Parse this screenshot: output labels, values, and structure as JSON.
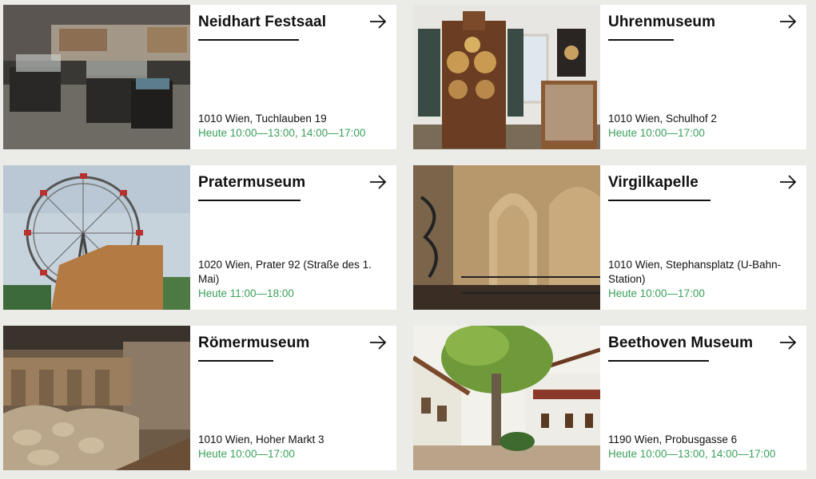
{
  "museums": [
    {
      "title": "Neidhart Festsaal",
      "address": "1010 Wien, Tuchlauben 19",
      "hours": "Heute 10:00—13:00, 14:00—17:00"
    },
    {
      "title": "Uhrenmuseum",
      "address": "1010 Wien, Schulhof 2",
      "hours": "Heute 10:00—17:00"
    },
    {
      "title": "Pratermuseum",
      "address": "1020 Wien, Prater 92 (Straße des 1. Mai)",
      "hours": "Heute 11:00—18:00"
    },
    {
      "title": "Virgilkapelle",
      "address": "1010 Wien, Stephansplatz (U-Bahn-Station)",
      "hours": "Heute 10:00—17:00"
    },
    {
      "title": "Römermuseum",
      "address": "1010 Wien, Hoher Markt 3",
      "hours": "Heute 10:00—17:00"
    },
    {
      "title": "Beethoven Museum",
      "address": "1190 Wien, Probusgasse 6",
      "hours": "Heute 10:00—13:00, 14:00—17:00"
    }
  ],
  "icons": {
    "arrow": "arrow-right-icon"
  },
  "colors": {
    "background": "#ebebe7",
    "card": "#ffffff",
    "text": "#111111",
    "hours_open": "#3aa05a"
  }
}
